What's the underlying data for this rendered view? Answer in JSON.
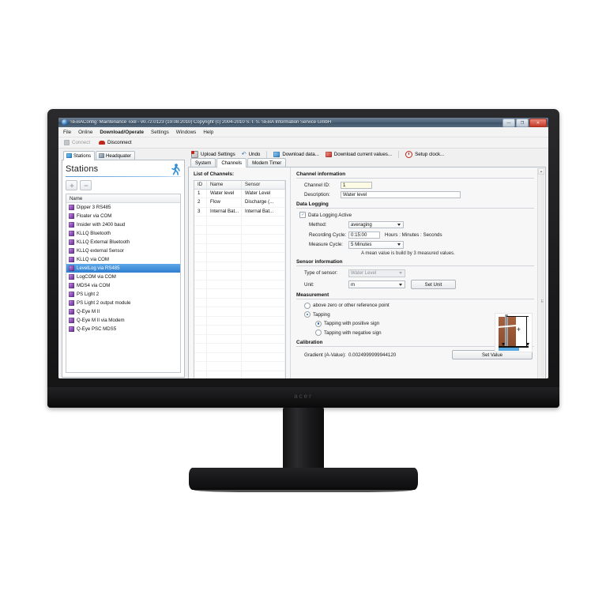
{
  "window": {
    "title": "SEBAConfig: Maintenance Tool - v0.72.0123 (19.08.2010) Copyright (c) 2004-2010 S. I. S. SEBA Information Service GmbH",
    "app_icon": "globe-icon",
    "minimize_label": "—",
    "maximize_label": "❐",
    "close_label": "✕"
  },
  "menu": {
    "items": [
      {
        "label": "File",
        "active": false
      },
      {
        "label": "Online",
        "active": false
      },
      {
        "label": "Download/Operate",
        "active": true
      },
      {
        "label": "Settings",
        "active": false
      },
      {
        "label": "Windows",
        "active": false
      },
      {
        "label": "Help",
        "active": false
      }
    ]
  },
  "connection_toolbar": {
    "connect_label": "Connect",
    "connect_enabled": false,
    "disconnect_label": "Disconnect",
    "disconnect_enabled": true
  },
  "sidebar": {
    "tabs": [
      {
        "label": "Stations",
        "icon": "stations-icon",
        "selected": true
      },
      {
        "label": "Headquater",
        "icon": "headquarter-icon",
        "selected": false
      }
    ],
    "heading": "Stations",
    "heading_icon": "walking-person-icon",
    "add_button": "+",
    "remove_button": "−",
    "list_header": "Name",
    "stations": [
      {
        "label": "Dipper 3 RS485",
        "selected": false
      },
      {
        "label": "Floater via COM",
        "selected": false
      },
      {
        "label": "Insider with 2400 baud",
        "selected": false
      },
      {
        "label": "KLLQ Bluetooth",
        "selected": false
      },
      {
        "label": "KLLQ External Bluetooth",
        "selected": false
      },
      {
        "label": "KLLQ external Sensor",
        "selected": false
      },
      {
        "label": "KLLQ via COM",
        "selected": false
      },
      {
        "label": "LevelLog via RS485",
        "selected": true
      },
      {
        "label": "LogCOM via COM",
        "selected": false
      },
      {
        "label": "MDS4 via COM",
        "selected": false
      },
      {
        "label": "PS Light 2",
        "selected": false
      },
      {
        "label": "PS Light 2 output module",
        "selected": false
      },
      {
        "label": "Q-Eye M II",
        "selected": false
      },
      {
        "label": "Q-Eye M II via Modem",
        "selected": false
      },
      {
        "label": "Q-Eye PSC MDS5",
        "selected": false
      }
    ]
  },
  "toolbar": {
    "upload_settings": "Upload Settings",
    "undo": "Undo",
    "download_data": "Download data...",
    "download_current_values": "Download current values...",
    "setup_clock": "Setup clock..."
  },
  "tabs": [
    {
      "label": "System",
      "selected": false
    },
    {
      "label": "Channels",
      "selected": true
    },
    {
      "label": "Modem Timer",
      "selected": false
    }
  ],
  "channels_panel": {
    "title": "List of Channels:",
    "columns": [
      "ID",
      "Name",
      "Sensor"
    ],
    "rows": [
      {
        "id": "1",
        "name": "Water level",
        "sensor": "Water Level"
      },
      {
        "id": "2",
        "name": "Flow",
        "sensor": "Discharge (..."
      },
      {
        "id": "3",
        "name": "Internal Bat...",
        "sensor": "Internal Bat..."
      }
    ]
  },
  "channel_information": {
    "title": "Channel information",
    "channel_id_label": "Channel ID:",
    "channel_id_value": "1",
    "description_label": "Description:",
    "description_value": "Water level"
  },
  "data_logging": {
    "title": "Data Logging",
    "active_label": "Data Logging Active",
    "active_checked": true,
    "method_label": "Method:",
    "method_value": "averaging",
    "recording_cycle_label": "Recording Cycle:",
    "recording_cycle_value": "0:15:00",
    "recording_cycle_units": "Hours : Minutes : Seconds",
    "measure_cycle_label": "Measure Cycle:",
    "measure_cycle_value": "5 Minutes",
    "note": "A mean value is build by 3 measured values."
  },
  "sensor_information": {
    "title": "Sensor information",
    "type_label": "Type of sensor:",
    "type_value": "Water Level",
    "type_disabled": true,
    "unit_label": "Unit:",
    "unit_value": "m",
    "set_unit_button": "Set Unit"
  },
  "measurement": {
    "title": "Measurement",
    "options": [
      {
        "label": "above zero or other reference point",
        "selected": false,
        "indent": 0
      },
      {
        "label": "Tapping",
        "selected": true,
        "indent": 0
      },
      {
        "label": "Tapping with positive sign",
        "selected": true,
        "indent": 1
      },
      {
        "label": "Tapping with negative sign",
        "selected": false,
        "indent": 1
      }
    ],
    "illustration": "borehole-tapping-diagram",
    "illustration_sign": "+"
  },
  "calibration": {
    "title": "Calibration",
    "gradient_label": "Gradient (A-Value):",
    "gradient_value": "0.0024999999944120",
    "set_value_button": "Set Value"
  },
  "scrollbar": {
    "up_arrow": "▲",
    "down_arrow": "▼",
    "grip": "E"
  },
  "monitor": {
    "brand": "acer"
  },
  "colors": {
    "accent": "#2f7fd1",
    "titlebar": "#4e6379",
    "close": "#c33a26",
    "yellow_field": "#fdfbe3"
  }
}
